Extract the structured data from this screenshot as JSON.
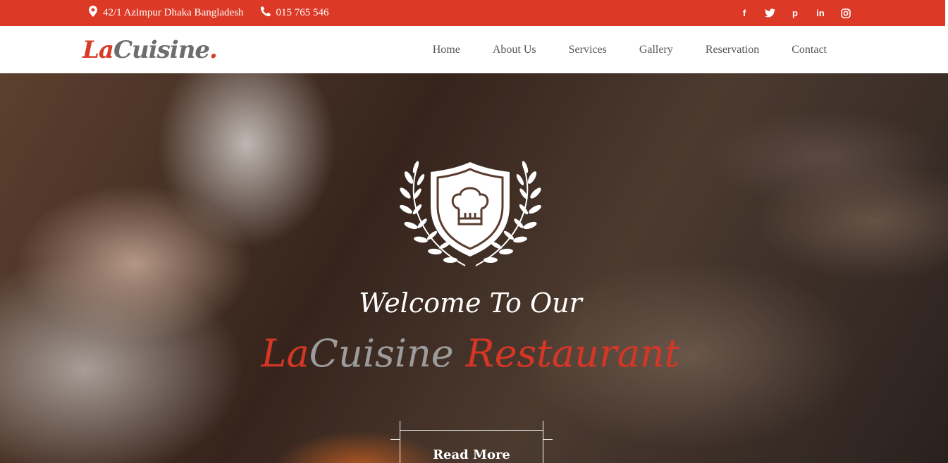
{
  "topbar": {
    "address": "42/1 Azimpur Dhaka Bangladesh",
    "phone": "015 765 546",
    "social": [
      "facebook-icon",
      "twitter-icon",
      "pinterest-icon",
      "linkedin-icon",
      "instagram-icon"
    ],
    "social_glyphs": [
      "f",
      "🐦",
      "p",
      "in",
      "◎"
    ],
    "color": "#dc3a26"
  },
  "logo": {
    "part1": "La",
    "part2": "Cuisine",
    "dot": "."
  },
  "nav": {
    "items": [
      "Home",
      "About Us",
      "Services",
      "Gallery",
      "Reservation",
      "Contact"
    ]
  },
  "hero": {
    "welcome": "Welcome To Our",
    "brand_part1": "La",
    "brand_part2": "Cuisine",
    "brand_part3": "Restaurant",
    "cta": "Read More"
  },
  "colors": {
    "accent": "#dc3a26",
    "muted": "#9c9c9c"
  }
}
